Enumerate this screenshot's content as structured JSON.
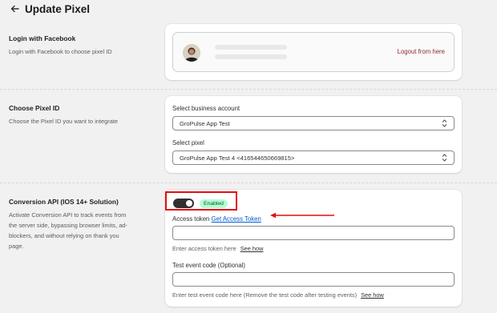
{
  "header": {
    "title": "Update Pixel",
    "back_icon": "arrow-left-icon"
  },
  "login_section": {
    "title": "Login with Facebook",
    "description": "Login with Facebook to choose pixel ID",
    "logout_label": "Logout from here"
  },
  "pixel_section": {
    "title": "Choose Pixel ID",
    "description": "Choose the Pixel ID you want to integrate",
    "business_label": "Select business account",
    "business_value": "GroPulse App Test",
    "pixel_label": "Select pixel",
    "pixel_value": "GroPulse App Test 4 <416544650669815>"
  },
  "conversion_section": {
    "title": "Conversion API (IOS 14+ Solution)",
    "description_lines": [
      "Activate Conversion API to track events from",
      "the server side, bypassing browser limits, ad-",
      "blockers, and without relying on thank you",
      "page."
    ],
    "toggle_on": true,
    "status_badge": "Enabled",
    "access_token_label": "Access token",
    "access_token_link": "Get Access Token",
    "access_token_value": "",
    "access_token_help": "Enter access token here",
    "access_token_see_how": "See how",
    "test_code_label": "Test event code (Optional)",
    "test_code_value": "",
    "test_code_help": "Enter test event code here (Remove the test code after testing events)",
    "test_code_see_how": "See how"
  },
  "colors": {
    "highlight": "#e10f0f",
    "link": "#005bd3",
    "logout": "#8a2d2d",
    "badge_bg": "#b4fed2",
    "toggle_on": "#303030"
  }
}
